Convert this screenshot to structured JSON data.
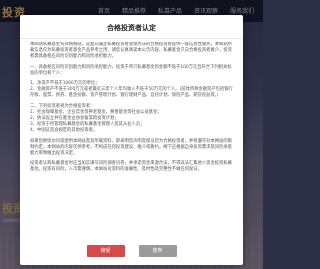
{
  "background": {
    "logo": "投资",
    "nav": [
      "首页",
      "精品推荐",
      "私募产品",
      "资讯观察",
      "服务我们"
    ],
    "hero_title": "投资",
    "hero_sub": "Investment"
  },
  "modal": {
    "title": "合格投资者认定",
    "paragraphs": [
      "本网站私募基金有效网络站，是面向满足私募投资者管理办法的合格投资者提供一般信息性服务。本网站所载信息仅为私募投资者基金产品参考之用，请您认真阅读本公告内容。私募基金只向合格投资者推介，投资者需具备相应风险识别能力和风险承担能力。",
      "一、具备相应风险识别能力和风险承担能力，投资于单只私募基金的金额不低于100万元且符合下列相关标准的单位和个人：",
      "1、净资产不低于1000万元的单位；",
      "2、金融资产不低于300万元或者最近三年个人年均收入不低于50万元的个人。(前款所称金融资产包括银行存款、股票、债券、基金份额、资产管理计划、银行理财产品、信托计划、保险产品、期货权益等。)",
      "二、下列投资者视为合格投资者：",
      "1、社会保障基金、企业年金等养老基金，慈善基金等社会公益基金；",
      "2、依法设立并在基金业协会备案的投资计划；",
      "3、投资于所管理私募基金的私募基金管理人及其从业人员；",
      "4、中国证监会规定的其他投资者。",
      "如果您继续访问或使用本网站及其所载资料，即表明您声明及保证您为合格投资者，并将遵守对本网站的限制约定。本网站的内容仅供参考，不构成任何投资建议、推介或要约，阁下应根据自身投资需求及风险承受能力审慎做出投资决定。",
      "投资者认购私募基金时应当如实填写风险调查问卷，并承诺资金来源合法，不得非法汇集他人资金投资私募基金。投资有风险，入市需谨慎，本网站对资料的准确性、及时性及完整性不做任何保证。"
    ],
    "agree_label": "接受",
    "cancel_label": "放弃"
  }
}
